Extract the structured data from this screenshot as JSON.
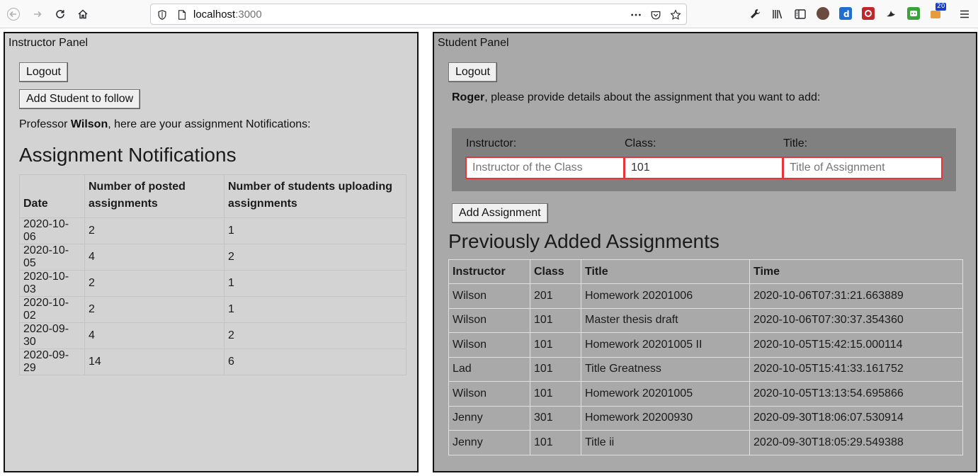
{
  "browser": {
    "url_host": "localhost",
    "url_port": ":3000",
    "badge_count": "20"
  },
  "instructor": {
    "panel_title": "Instructor Panel",
    "logout_label": "Logout",
    "add_student_label": "Add Student to follow",
    "greeting_prefix": "Professor ",
    "professor_name": "Wilson",
    "greeting_suffix": ", here are your assignment Notifications:",
    "notifications_heading": "Assignment Notifications",
    "columns": [
      "Date",
      "Number of posted assignments",
      "Number of students uploading assignments"
    ],
    "rows": [
      [
        "2020-10-06",
        "2",
        "1"
      ],
      [
        "2020-10-05",
        "4",
        "2"
      ],
      [
        "2020-10-03",
        "2",
        "1"
      ],
      [
        "2020-10-02",
        "2",
        "1"
      ],
      [
        "2020-09-30",
        "4",
        "2"
      ],
      [
        "2020-09-29",
        "14",
        "6"
      ]
    ]
  },
  "student": {
    "panel_title": "Student Panel",
    "logout_label": "Logout",
    "student_name": "Roger",
    "prompt_suffix": ", please provide details about the assignment that you want to add:",
    "form": {
      "instructor_label": "Instructor:",
      "instructor_placeholder": "Instructor of the Class",
      "instructor_value": "",
      "class_label": "Class:",
      "class_value": "101",
      "title_label": "Title:",
      "title_placeholder": "Title of Assignment",
      "title_value": ""
    },
    "add_assignment_label": "Add Assignment",
    "previous_heading": "Previously Added Assignments",
    "columns": [
      "Instructor",
      "Class",
      "Title",
      "Time"
    ],
    "rows": [
      [
        "Wilson",
        "201",
        "Homework 20201006",
        "2020-10-06T07:31:21.663889"
      ],
      [
        "Wilson",
        "101",
        "Master thesis draft",
        "2020-10-06T07:30:37.354360"
      ],
      [
        "Wilson",
        "101",
        "Homework 20201005 II",
        "2020-10-05T15:42:15.000114"
      ],
      [
        "Lad",
        "101",
        "Title Greatness",
        "2020-10-05T15:41:33.161752"
      ],
      [
        "Wilson",
        "101",
        "Homework 20201005",
        "2020-10-05T13:13:54.695866"
      ],
      [
        "Jenny",
        "301",
        "Homework 20200930",
        "2020-09-30T18:06:07.530914"
      ],
      [
        "Jenny",
        "101",
        "Title ii",
        "2020-09-30T18:05:29.549388"
      ]
    ]
  }
}
